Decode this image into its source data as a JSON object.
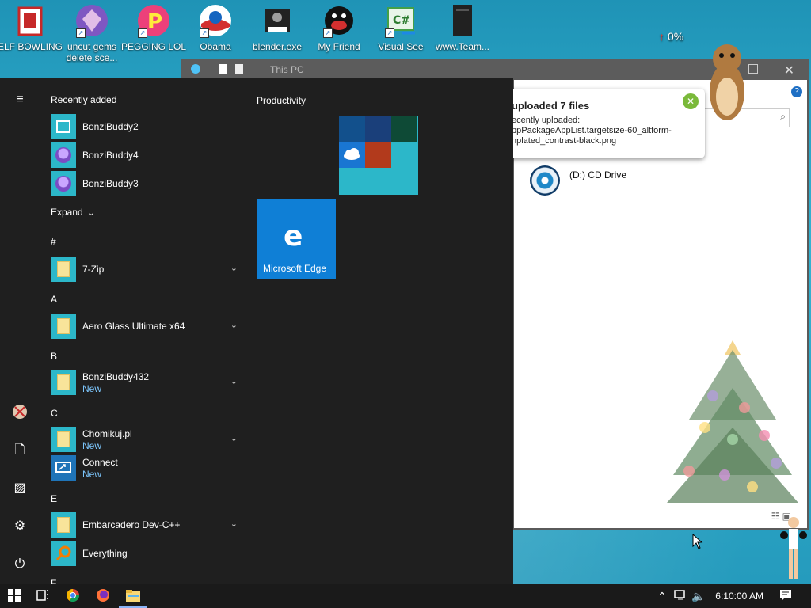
{
  "desktop": {
    "icons": [
      {
        "label": "ELF BOWLING"
      },
      {
        "label": "uncut gems delete sce..."
      },
      {
        "label": "PEGGING LOL"
      },
      {
        "label": "Obama"
      },
      {
        "label": "blender.exe"
      },
      {
        "label": "My Friend"
      },
      {
        "label": "Visual See"
      },
      {
        "label": "www.Team..."
      }
    ],
    "cpu_percent": "0%"
  },
  "explorer": {
    "title": "This PC",
    "drive_label": "(D:) CD Drive",
    "help": "?"
  },
  "toast": {
    "title": "uploaded 7 files",
    "line1": "ecently uploaded:",
    "line2": "ppPackageAppList.targetsize-60_altform-",
    "line3": "nplated_contrast-black.png"
  },
  "start_menu": {
    "recently_added": "Recently added",
    "recent": [
      "BonziBuddy2",
      "BonziBuddy4",
      "BonziBuddy3"
    ],
    "expand": "Expand",
    "sections": {
      "hash": "#",
      "a": "A",
      "b": "B",
      "c": "C",
      "e": "E",
      "f": "F"
    },
    "apps": {
      "zip": "7-Zip",
      "aero": "Aero Glass Ultimate x64",
      "bonzi432": "BonziBuddy432",
      "chomikuj": "Chomikuj.pl",
      "connect": "Connect",
      "embarcadero": "Embarcadero Dev-C++",
      "everything": "Everything"
    },
    "new_badge": "New",
    "productivity": "Productivity",
    "edge_label": "Microsoft Edge"
  },
  "taskbar": {
    "time": "6:10:00 AM"
  },
  "colors": {
    "accent": "#0f7fd6",
    "tile": "#2cb7c9",
    "menu_bg": "#1f1f1f",
    "new_badge": "#7ec8ff"
  }
}
